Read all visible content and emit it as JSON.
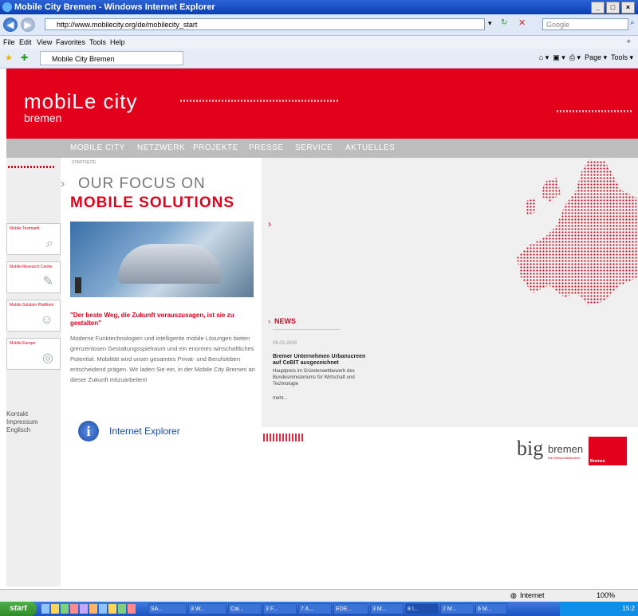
{
  "window": {
    "title": "Mobile City Bremen - Windows Internet Explorer"
  },
  "address": {
    "url": "http://www.mobilecity.org/de/mobilecity_start",
    "search_placeholder": "Google"
  },
  "menu": [
    "File",
    "Edit",
    "View",
    "Favorites",
    "Tools",
    "Help"
  ],
  "tab": {
    "label": "Mobile City Bremen"
  },
  "command_bar": {
    "page": "Page",
    "tools": "Tools"
  },
  "site": {
    "logo": "mobiLe city",
    "logo_sub": "bremen",
    "nav": [
      "MOBILE CITY",
      "NETZWERK",
      "PROJEKTE",
      "PRESSE",
      "SERVICE",
      "AKTUELLES"
    ],
    "breadcrumb": "STARTSEITE",
    "headline_1": "OUR FOCUS ON",
    "headline_2": "MOBILE SOLUTIONS",
    "quote": "\"Der beste Weg, die Zukunft vorauszusagen, ist sie zu gestalten\"",
    "body": "Moderne Funktechnologien und intelligente mobile Lösungen bieten grenzenlosen Gestaltungsspielraum und ein enormes wirtschaftliches Potential. Mobilität wird unser gesamtes Privat- und Berufsleben entscheidend prägen. Wir laden Sie ein, in der Mobile City Bremen an dieser Zukunft mitzuarbeiten!",
    "ie_label": "Internet Explorer",
    "side_boxes": [
      "Mobile Testmarkt",
      "Mobile Research Center",
      "Mobile Solution Plattform",
      "Mobile Europe"
    ],
    "side_links": [
      "Kontakt",
      "Impressum",
      "Englisch"
    ],
    "news": {
      "heading": "NEWS",
      "date": "06.03.2008",
      "title": "Bremer Unternehmen Urbanscreen auf CeBIT ausgezeichnet",
      "text": "Hauptpreis im Gründerwettbewerb des Bundesministeriums für Wirtschaft und Technologie",
      "more": "mehr..."
    },
    "big_logo": "big",
    "big_logo_2": "bremen",
    "big_sub": "Die Wirtschaftsförderer",
    "bremen_badge": "Bremen"
  },
  "status": {
    "zone": "Internet",
    "zoom": "100%"
  },
  "taskbar": {
    "start": "start",
    "items": [
      "SA...",
      "3 W...",
      "Cal...",
      "3 F...",
      "7 A...",
      "EDE...",
      "3 M...",
      "8 I...",
      "2 M...",
      "6 M..."
    ],
    "clock": "15:2"
  },
  "colors": {
    "brand_red": "#e3001b",
    "nav_grey": "#bdbdbd"
  }
}
